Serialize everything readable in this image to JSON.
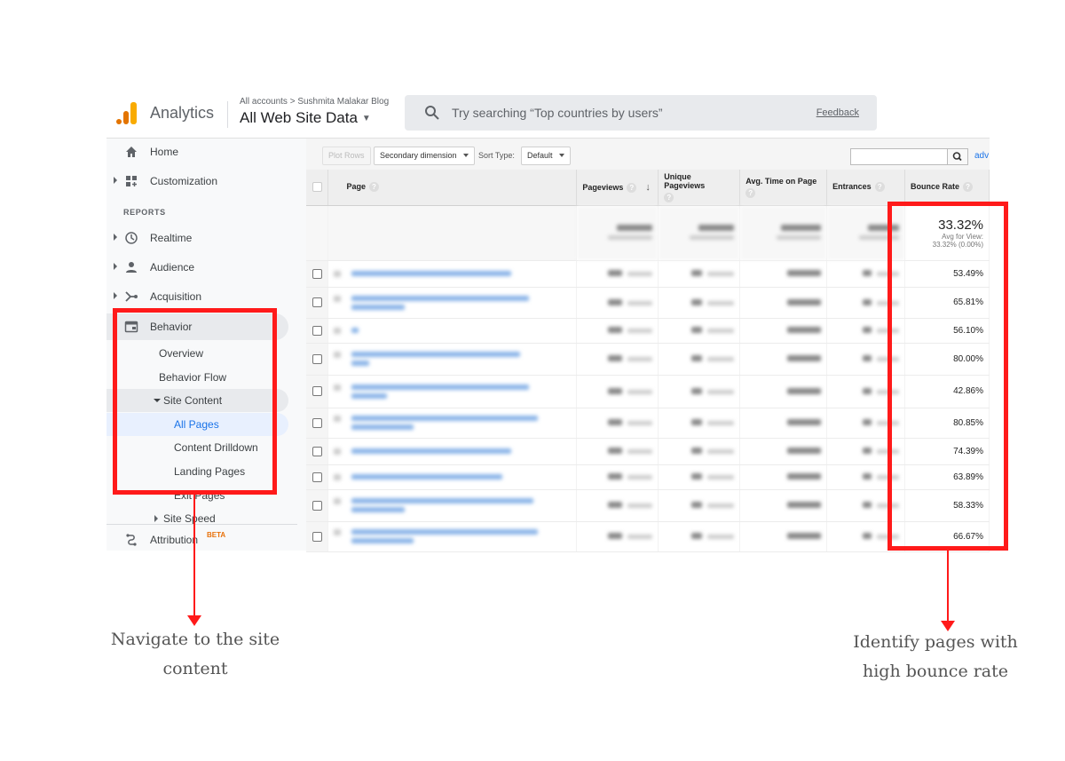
{
  "header": {
    "app_name": "Analytics",
    "breadcrumb": "All accounts > Sushmita Malakar Blog",
    "view_name": "All Web Site Data",
    "search_placeholder": "Try searching “Top countries by users”",
    "feedback_label": "Feedback"
  },
  "sidebar": {
    "home": "Home",
    "customization": "Customization",
    "reports_section": "REPORTS",
    "realtime": "Realtime",
    "audience": "Audience",
    "acquisition": "Acquisition",
    "behavior": "Behavior",
    "behavior_items": {
      "overview": "Overview",
      "behavior_flow": "Behavior Flow",
      "site_content": "Site Content",
      "all_pages": "All Pages",
      "content_drilldown": "Content Drilldown",
      "landing_pages": "Landing Pages",
      "exit_pages": "Exit Pages",
      "site_speed": "Site Speed"
    },
    "attribution": "Attribution",
    "attribution_badge": "BETA"
  },
  "toolbar": {
    "plot_rows": "Plot Rows",
    "secondary_dimension": "Secondary dimension",
    "sort_type_label": "Sort Type:",
    "sort_type_value": "Default",
    "advanced_link": "adv"
  },
  "table": {
    "columns": {
      "page": "Page",
      "pageviews": "Pageviews",
      "unique_pageviews": "Unique Pageviews",
      "avg_time_on_page": "Avg. Time on Page",
      "entrances": "Entrances",
      "bounce_rate": "Bounce Rate"
    },
    "summary": {
      "bounce_rate": "33.32%",
      "avg_for_view_label": "Avg for View:",
      "avg_for_view_value": "33.32% (0.00%)"
    },
    "rows": [
      {
        "bounce_rate": "53.49%"
      },
      {
        "bounce_rate": "65.81%"
      },
      {
        "bounce_rate": "56.10%"
      },
      {
        "bounce_rate": "80.00%"
      },
      {
        "bounce_rate": "42.86%"
      },
      {
        "bounce_rate": "80.85%"
      },
      {
        "bounce_rate": "74.39%"
      },
      {
        "bounce_rate": "63.89%"
      },
      {
        "bounce_rate": "58.33%"
      },
      {
        "bounce_rate": "66.67%"
      }
    ]
  },
  "annotations": {
    "left_line1": "Navigate to the site",
    "left_line2": "content",
    "right_line1": "Identify pages with",
    "right_line2": "high bounce rate"
  },
  "colors": {
    "highlight": "#ff1a1a",
    "ga_orange": "#e37400",
    "ga_yellow": "#f9ab00",
    "active_blue": "#1a73e8"
  }
}
